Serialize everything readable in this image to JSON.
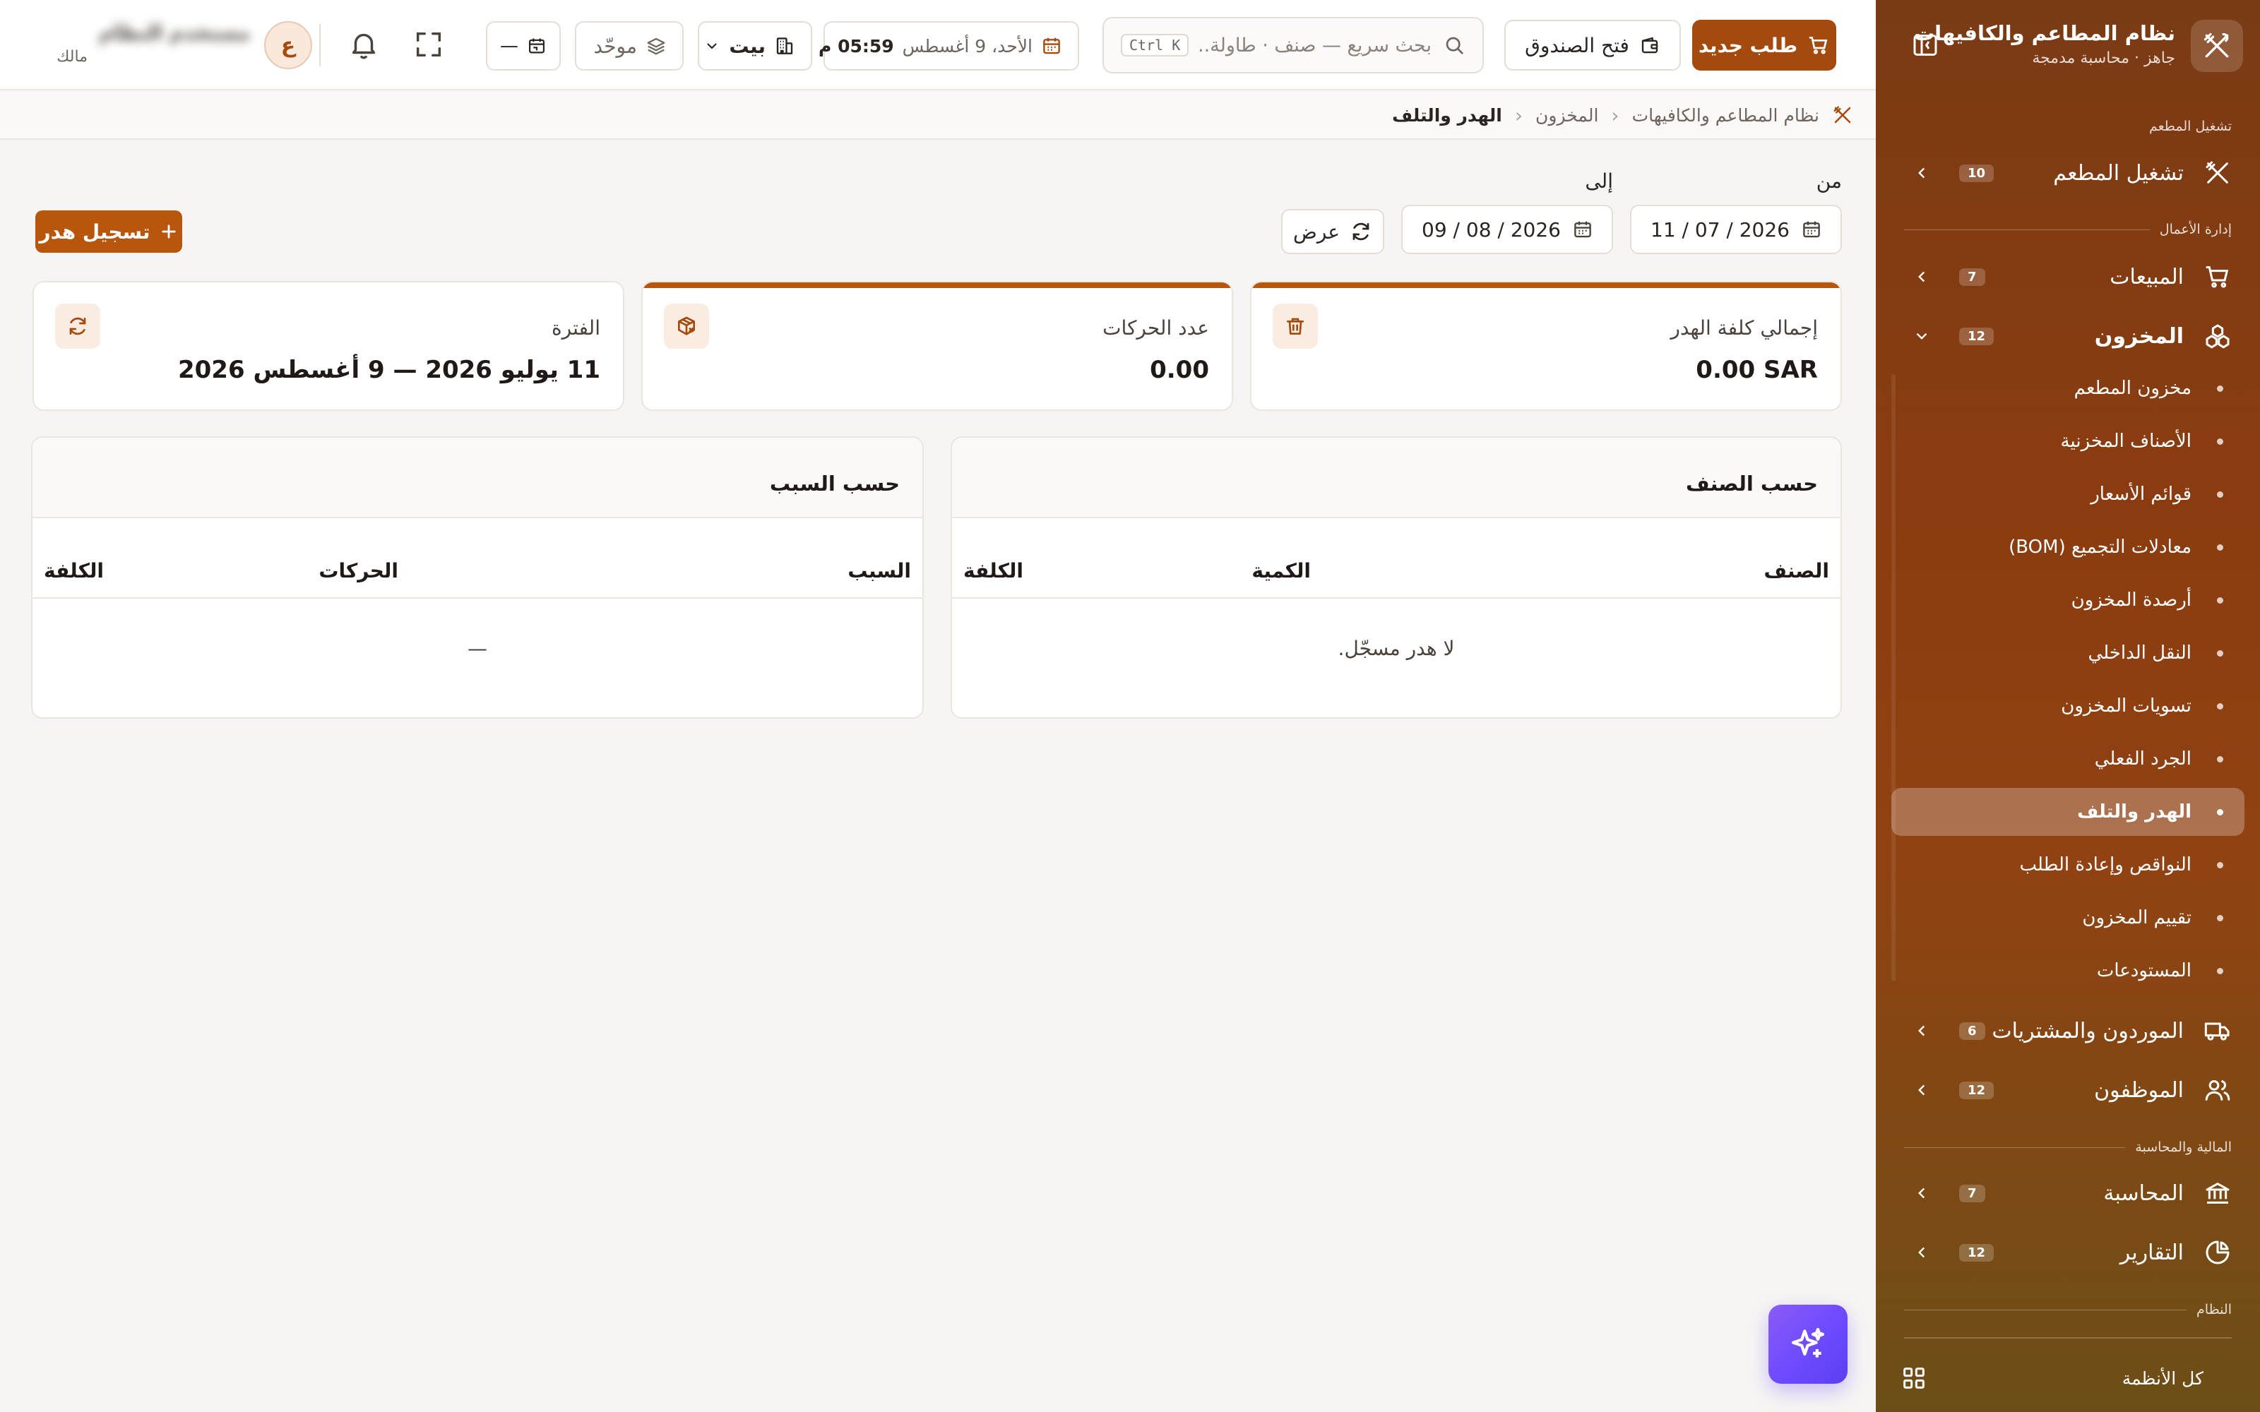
{
  "sidebar": {
    "brand_title": "نظام المطاعم والكافيهات",
    "brand_subtitle": "جاهز · محاسبة مدمجة",
    "sections": {
      "restaurant_ops": "تشغيل المطعم",
      "business": "إدارة الأعمال",
      "finance": "المالية والمحاسبة",
      "system": "النظام"
    },
    "items": {
      "restaurant_ops": {
        "label": "تشغيل المطعم",
        "count": "10"
      },
      "sales": {
        "label": "المبيعات",
        "count": "7"
      },
      "inventory": {
        "label": "المخزون",
        "count": "12"
      },
      "suppliers": {
        "label": "الموردون والمشتريات",
        "count": "6"
      },
      "employees": {
        "label": "الموظفون",
        "count": "12"
      },
      "accounting": {
        "label": "المحاسبة",
        "count": "7"
      },
      "reports": {
        "label": "التقارير",
        "count": "12"
      }
    },
    "inventory_sub": [
      "مخزون المطعم",
      "الأصناف المخزنية",
      "قوائم الأسعار",
      "معادلات التجميع (BOM)",
      "أرصدة المخزون",
      "النقل الداخلي",
      "تسويات المخزون",
      "الجرد الفعلي",
      "الهدر والتلف",
      "النواقص وإعادة الطلب",
      "تقييم المخزون",
      "المستودعات"
    ],
    "active_sub": "الهدر والتلف",
    "all_systems": "كل الأنظمة"
  },
  "header": {
    "new_order": "طلب جديد",
    "open_cash": "فتح الصندوق",
    "search_placeholder": "بحث سريع — صنف · طاولة...",
    "shortcut": "Ctrl K",
    "datetime_date": "الأحد، 9 أغسطس",
    "datetime_time": "05:59 م",
    "branch": "بيت",
    "mode": "موحّد",
    "period_placeholder": "—",
    "avatar_initial": "ع",
    "user_name": "مستخدم النظام",
    "user_role": "مالك"
  },
  "breadcrumb": {
    "root": "نظام المطاعم والكافيهات",
    "parent": "المخزون",
    "current": "الهدر والتلف"
  },
  "filters": {
    "from_label": "من",
    "to_label": "إلى",
    "from_date": "11 / 07 / 2026",
    "to_date": "09 / 08 / 2026",
    "view_label": "عرض",
    "record_label": "تسجيل هدر"
  },
  "stats": {
    "total_cost": {
      "label": "إجمالي كلفة الهدر",
      "value": "0.00 SAR"
    },
    "movements": {
      "label": "عدد الحركات",
      "value": "0.00"
    },
    "period": {
      "label": "الفترة",
      "value": "11 يوليو 2026 — 9 أغسطس 2026"
    }
  },
  "by_item": {
    "title": "حسب الصنف",
    "columns": [
      "الصنف",
      "الكمية",
      "الكلفة"
    ],
    "empty": "لا هدر مسجّل."
  },
  "by_reason": {
    "title": "حسب السبب",
    "columns": [
      "السبب",
      "الحركات",
      "الكلفة"
    ],
    "empty": "—"
  },
  "colors": {
    "accent": "#a44a0e",
    "accent_light": "#b8560d",
    "fab": "#6d4aff"
  }
}
